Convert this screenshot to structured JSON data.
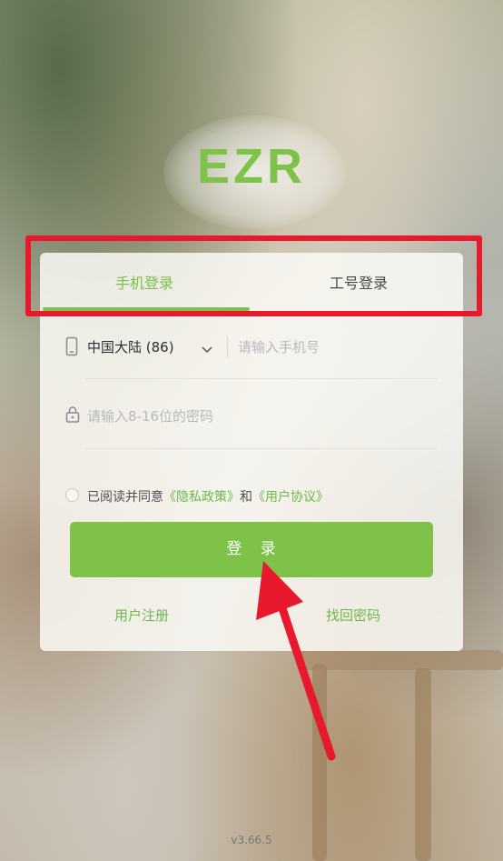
{
  "app": {
    "logo_text": "EZR",
    "version": "v3.66.5"
  },
  "tabs": [
    {
      "label": "手机登录",
      "active": true
    },
    {
      "label": "工号登录",
      "active": false
    }
  ],
  "phone": {
    "country": "中国大陆 (86)",
    "placeholder": "请输入手机号",
    "value": ""
  },
  "password": {
    "placeholder": "请输入8-16位的密码",
    "value": ""
  },
  "agreement": {
    "checked": false,
    "prefix": "已阅读并同意",
    "privacy_link": "《隐私政策》",
    "and": "和",
    "user_link": "《用户协议》"
  },
  "login_button": "登   录",
  "links": {
    "register": "用户注册",
    "forgot": "找回密码"
  },
  "colors": {
    "brand_green": "#7fc24a",
    "tab_active_text": "#7cbf4a",
    "link_green": "#6fb84a",
    "highlight_red": "#e8192c",
    "arrow_red": "#e8192c"
  },
  "icons": [
    "phone-icon",
    "chevron-down-icon",
    "lock-icon",
    "radio-unchecked-icon"
  ]
}
